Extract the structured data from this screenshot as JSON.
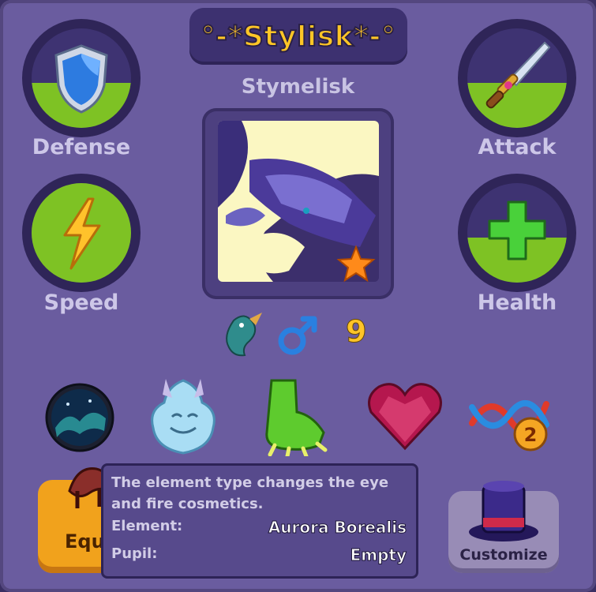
{
  "pet": {
    "nickname": "°-*Stylisk*-°",
    "species": "Stymelisk",
    "level": "9",
    "gender_icon": "male-symbol-icon",
    "element_icon": "water-dragon-icon"
  },
  "stats": [
    {
      "label": "Defense",
      "icon": "shield-icon",
      "fill": 0.45
    },
    {
      "label": "Attack",
      "icon": "sword-icon",
      "fill": 0.45
    },
    {
      "label": "Speed",
      "icon": "lightning-icon",
      "fill": 1.0
    },
    {
      "label": "Health",
      "icon": "plus-icon",
      "fill": 0.45
    }
  ],
  "equipment_slots": [
    "aurora-orb-icon",
    "fluffy-dragon-head-icon",
    "green-claw-icon",
    "ruby-heart-icon",
    "dna-icon"
  ],
  "dna_badge": "2",
  "buttons": {
    "equip": "Equ",
    "customize": "Customize"
  },
  "tooltip": {
    "description": "The element type changes the eye and fire cosmetics.",
    "element_label": "Element:",
    "element_value": "Aurora Borealis",
    "pupil_label": "Pupil:",
    "pupil_value": "Empty"
  },
  "colors": {
    "panel": "#6a5c9f",
    "title": "#ffc626",
    "stat_fill": "#7ec224",
    "equip_button": "#f1a21c"
  }
}
